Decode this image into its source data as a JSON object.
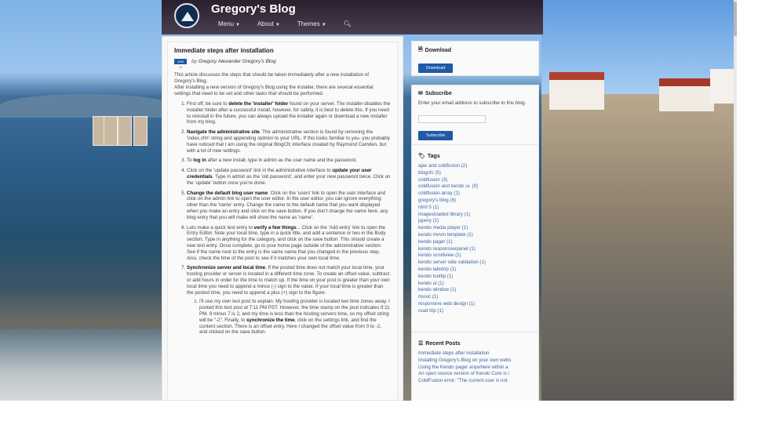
{
  "header": {
    "blog_title": "Gregory's Blog",
    "nav": [
      {
        "label": "Menu"
      },
      {
        "label": "About"
      },
      {
        "label": "Themes"
      }
    ]
  },
  "post": {
    "title": "Immediate steps after installation",
    "date_month": "JUN",
    "date_day": "13",
    "by": "by",
    "author": "Gregory Alexander Gregory's Blog",
    "intro1": "This article discusses the steps that should be taken immediately after a new installation of Gregory's Blog.",
    "intro2": "After installing a new version of Gregory's Blog using the installer, there are several essential settings that need to be set and other tasks that should be performed.",
    "steps": [
      {
        "pre": "First off, be sure to ",
        "bold": "delete the 'installer' folder",
        "post": " found on your server. The installer disables the installer folder after a successful install, however, for safety, it is best to delete this. If you need to reinstall in the future, you can always upload the installer again or download a new installer from my blog."
      },
      {
        "pre": "",
        "bold": "Navigate the administrative site",
        "post": ". The administrative section is found by removing the 'index.cfm' string and appending /admin/ to your URL. If this looks familiar to you- you probably have noticed that I am using the original BlogCfc interface created by Raymond Camden, but with a lot of new settings."
      },
      {
        "pre": "To ",
        "bold": "log in",
        "post": " after a new install, type in admin as the user name and the password."
      },
      {
        "pre": "Click on the 'update password' link in the administrative interface to ",
        "bold": "update your user credentials",
        "post": ". Type in admin as the 'old password', and enter your new password twice. Click on the 'update' button once you're done."
      },
      {
        "pre": "",
        "bold": "Change the default blog user name",
        "post": ". Click on the 'users' link to open the user interface and click on the admin link to open the user editor. In the user editor, you can ignore everything other than the 'name' entry. Change the name to the default name that you want displayed when you make an entry and click on the save button. If you don't change the name here, any blog entry that you will make will show the name as 'name'."
      },
      {
        "pre": "Lets make a quick test entry to ",
        "bold": "verify a few things",
        "post": "... Click on the 'Add entry' link to open the Entry Editor. Note your local time, type in a quick title, and add a sentence or two in the Body section. Type in anything for the category, and click on the save button. This should create a new test entry. Once complete, go to your home page outside of the administrative section. See if the name next to the entry is the same name that you changed in the previous step. Also, check the time of the post to see if it matches your own local time."
      },
      {
        "pre": "",
        "bold": "Synchronize server and local time",
        "post": ". If the posted time does not match your local time, your hosting provider or server is located in a different time zone. To create an offset value, subtract or add hours in order for the time to match up. If the time on your post is greater than your own local time you need to append a minus (-) sign to the value. If your local time is greater than the posted time, you need to append a plus (+) sign to the figure."
      }
    ],
    "substep": {
      "pre": "I'll use my own test post to explain. My hosting provider is located two time zones away. I posted this test post at 7:11 PM PST. However, the time stamp on the post indicates 9:11 PM. 9 minus 7 is 2, and my time is less than the hosting servers time, so my offset string will be \"-2\". Finally, to ",
      "bold": "synchronize the time",
      "post": ", click on the settings link, and find the content section. There is an offset entry. Here I changed the offset value from 0 to -2, and clicked on the save button."
    }
  },
  "sidebar": {
    "download": {
      "title": "Download",
      "button": "Download"
    },
    "subscribe": {
      "title": "Subscribe",
      "text": "Enter your email address to subscribe to this blog.",
      "placeholder": "",
      "button": "Subscribe"
    },
    "tags": {
      "title": "Tags",
      "items": [
        "ajax and coldfusion (2)",
        "blogcfc (5)",
        "coldfusion (3)",
        "coldfusion and kendo ui. (9)",
        "coldfusion array (1)",
        "gregory's blog (8)",
        "html 5 (1)",
        "imagesloaded library (1)",
        "jquery (1)",
        "kendo media player (1)",
        "kendo mvvm template (1)",
        "kendo pager (1)",
        "kendo responsivepanel (1)",
        "kendo scrollview (1)",
        "kendo server side validation (1)",
        "kendo tabstrip (1)",
        "kendo tooltip (1)",
        "kendo ui (1)",
        "kendo window (1)",
        "music (1)",
        "responsive web design (1)",
        "road trip (1)"
      ]
    },
    "recent": {
      "title": "Recent Posts",
      "items": [
        "Immediate steps after installation",
        "Installing Gregory's Blog on your own webs",
        "Using the Kendo pager anywhere within a",
        "An open source version of Kendo Core is i",
        "ColdFusion error: \"The current user is not"
      ]
    }
  },
  "colors": {
    "accent": "#1f5aa6",
    "link": "#3c63a6",
    "header": "#2a1f2c"
  },
  "icons": {
    "search": "search-icon",
    "download": "download-icon",
    "subscribe": "envelope-icon",
    "tags": "tag-icon",
    "recent": "list-icon"
  }
}
